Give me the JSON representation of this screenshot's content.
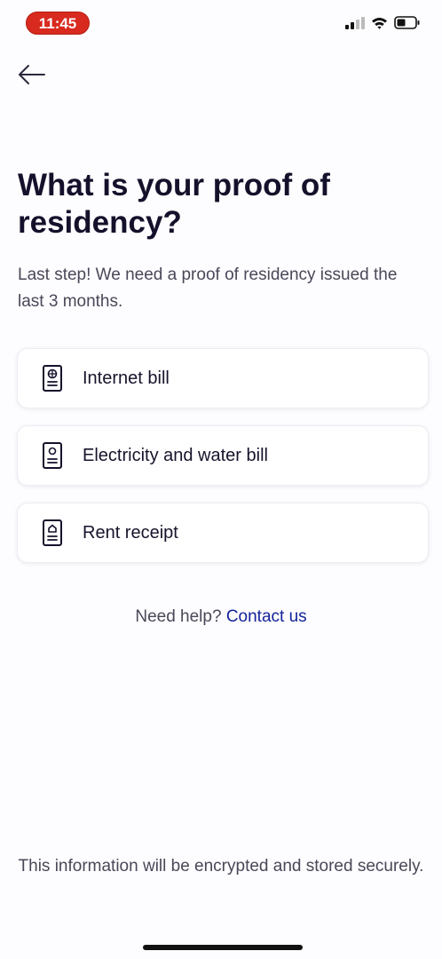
{
  "status_bar": {
    "time": "11:45",
    "icons": [
      "signal-icon",
      "wifi-icon",
      "battery-icon"
    ]
  },
  "header": {
    "back_icon": "arrow-left-icon"
  },
  "main": {
    "title": "What is your proof of residency?",
    "subtitle": "Last step! We need a proof of residency issued the last 3 months.",
    "options": [
      {
        "label": "Internet bill",
        "icon": "internet-bill-icon"
      },
      {
        "label": "Electricity and water bill",
        "icon": "utility-bill-icon"
      },
      {
        "label": "Rent receipt",
        "icon": "rent-receipt-icon"
      }
    ],
    "help": {
      "text": "Need help?",
      "link": "Contact us"
    }
  },
  "footer": {
    "text": "This information will be encrypted and stored securely."
  },
  "colors": {
    "link": "#14239a",
    "status_pill": "#d82a1e",
    "title": "#14112b"
  }
}
